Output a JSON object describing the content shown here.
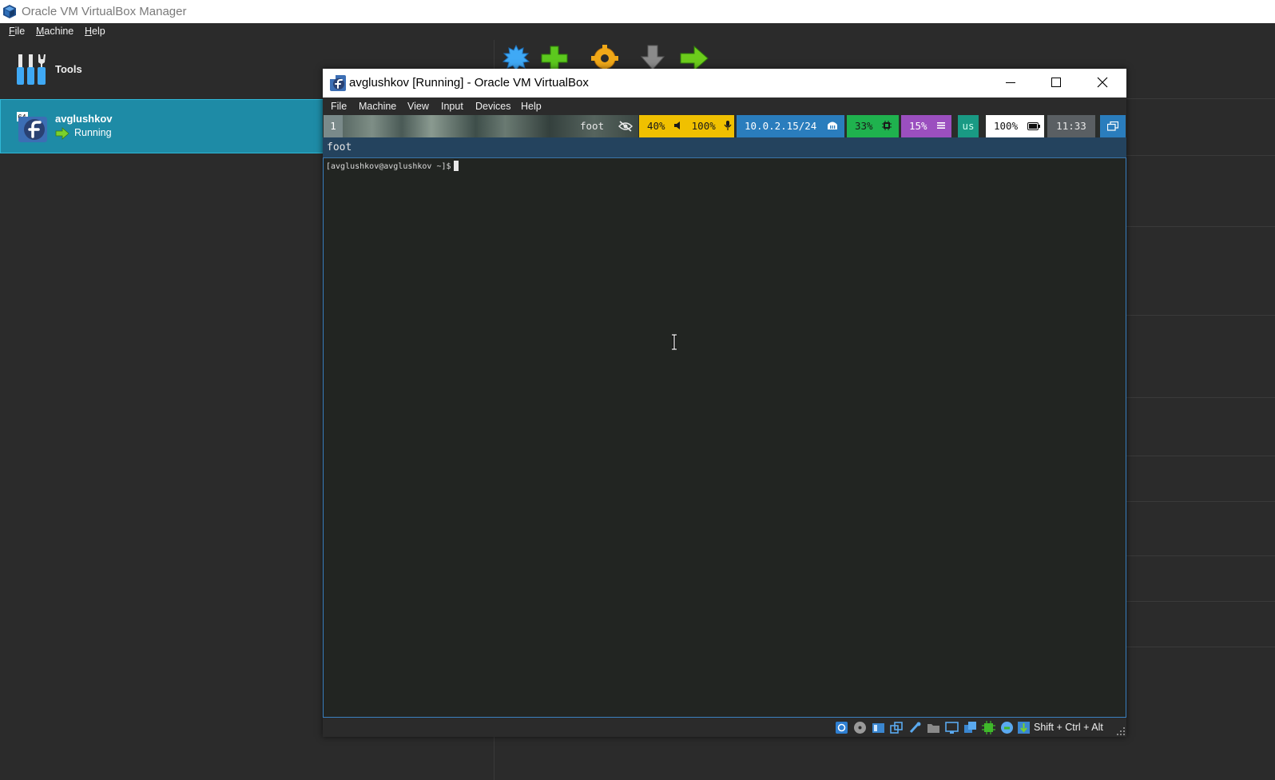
{
  "manager": {
    "title": "Oracle VM VirtualBox Manager",
    "menu": [
      {
        "key": "F",
        "rest": "ile"
      },
      {
        "key": "M",
        "rest": "achine"
      },
      {
        "key": "H",
        "rest": "elp"
      }
    ],
    "tools_label": "Tools",
    "vm": {
      "name": "avglushkov",
      "state": "Running",
      "os_badge": "64"
    },
    "toolbar_icons": [
      "new-icon",
      "add-icon",
      "settings-icon",
      "discard-icon",
      "start-icon"
    ]
  },
  "vm_window": {
    "title": "avglushkov [Running] - Oracle VM VirtualBox",
    "menu": [
      "File",
      "Machine",
      "View",
      "Input",
      "Devices",
      "Help"
    ],
    "guest": {
      "bar": {
        "workspace": "1",
        "app_title": "foot",
        "volume": "40%",
        "mic": "100%",
        "network": "10.0.2.15/24",
        "cpu": "33%",
        "memory": "15%",
        "layout": "us",
        "battery": "100%",
        "clock": "11:33"
      },
      "window_title": "foot",
      "prompt": "[avglushkov@avglushkov ~]$"
    },
    "status": {
      "icons": [
        "hard-disk-icon",
        "optical-disk-icon",
        "audio-icon",
        "network-icon",
        "usb-icon",
        "shared-folders-icon",
        "display-icon",
        "recording-icon",
        "cpu-icon",
        "mouse-integration-icon",
        "keyboard-capture-icon"
      ],
      "host_key": "Shift + Ctrl + Alt"
    }
  },
  "colors": {
    "accent": "#1e8ba6",
    "sound": "#f0c000",
    "network": "#2a7dbd",
    "cpu": "#1fb24e",
    "memory": "#9b4fbf",
    "layout": "#199a84"
  }
}
